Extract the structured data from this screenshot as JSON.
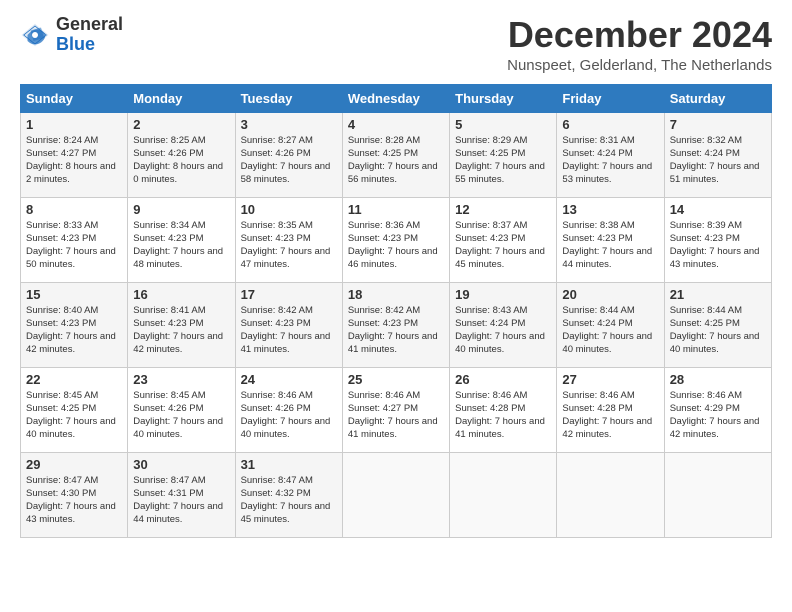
{
  "header": {
    "logo": {
      "general": "General",
      "blue": "Blue"
    },
    "title": "December 2024",
    "location": "Nunspeet, Gelderland, The Netherlands"
  },
  "calendar": {
    "columns": [
      "Sunday",
      "Monday",
      "Tuesday",
      "Wednesday",
      "Thursday",
      "Friday",
      "Saturday"
    ],
    "weeks": [
      [
        {
          "day": "1",
          "sunrise": "8:24 AM",
          "sunset": "4:27 PM",
          "daylight": "8 hours and 2 minutes."
        },
        {
          "day": "2",
          "sunrise": "8:25 AM",
          "sunset": "4:26 PM",
          "daylight": "8 hours and 0 minutes."
        },
        {
          "day": "3",
          "sunrise": "8:27 AM",
          "sunset": "4:26 PM",
          "daylight": "7 hours and 58 minutes."
        },
        {
          "day": "4",
          "sunrise": "8:28 AM",
          "sunset": "4:25 PM",
          "daylight": "7 hours and 56 minutes."
        },
        {
          "day": "5",
          "sunrise": "8:29 AM",
          "sunset": "4:25 PM",
          "daylight": "7 hours and 55 minutes."
        },
        {
          "day": "6",
          "sunrise": "8:31 AM",
          "sunset": "4:24 PM",
          "daylight": "7 hours and 53 minutes."
        },
        {
          "day": "7",
          "sunrise": "8:32 AM",
          "sunset": "4:24 PM",
          "daylight": "7 hours and 51 minutes."
        }
      ],
      [
        {
          "day": "8",
          "sunrise": "8:33 AM",
          "sunset": "4:23 PM",
          "daylight": "7 hours and 50 minutes."
        },
        {
          "day": "9",
          "sunrise": "8:34 AM",
          "sunset": "4:23 PM",
          "daylight": "7 hours and 48 minutes."
        },
        {
          "day": "10",
          "sunrise": "8:35 AM",
          "sunset": "4:23 PM",
          "daylight": "7 hours and 47 minutes."
        },
        {
          "day": "11",
          "sunrise": "8:36 AM",
          "sunset": "4:23 PM",
          "daylight": "7 hours and 46 minutes."
        },
        {
          "day": "12",
          "sunrise": "8:37 AM",
          "sunset": "4:23 PM",
          "daylight": "7 hours and 45 minutes."
        },
        {
          "day": "13",
          "sunrise": "8:38 AM",
          "sunset": "4:23 PM",
          "daylight": "7 hours and 44 minutes."
        },
        {
          "day": "14",
          "sunrise": "8:39 AM",
          "sunset": "4:23 PM",
          "daylight": "7 hours and 43 minutes."
        }
      ],
      [
        {
          "day": "15",
          "sunrise": "8:40 AM",
          "sunset": "4:23 PM",
          "daylight": "7 hours and 42 minutes."
        },
        {
          "day": "16",
          "sunrise": "8:41 AM",
          "sunset": "4:23 PM",
          "daylight": "7 hours and 42 minutes."
        },
        {
          "day": "17",
          "sunrise": "8:42 AM",
          "sunset": "4:23 PM",
          "daylight": "7 hours and 41 minutes."
        },
        {
          "day": "18",
          "sunrise": "8:42 AM",
          "sunset": "4:23 PM",
          "daylight": "7 hours and 41 minutes."
        },
        {
          "day": "19",
          "sunrise": "8:43 AM",
          "sunset": "4:24 PM",
          "daylight": "7 hours and 40 minutes."
        },
        {
          "day": "20",
          "sunrise": "8:44 AM",
          "sunset": "4:24 PM",
          "daylight": "7 hours and 40 minutes."
        },
        {
          "day": "21",
          "sunrise": "8:44 AM",
          "sunset": "4:25 PM",
          "daylight": "7 hours and 40 minutes."
        }
      ],
      [
        {
          "day": "22",
          "sunrise": "8:45 AM",
          "sunset": "4:25 PM",
          "daylight": "7 hours and 40 minutes."
        },
        {
          "day": "23",
          "sunrise": "8:45 AM",
          "sunset": "4:26 PM",
          "daylight": "7 hours and 40 minutes."
        },
        {
          "day": "24",
          "sunrise": "8:46 AM",
          "sunset": "4:26 PM",
          "daylight": "7 hours and 40 minutes."
        },
        {
          "day": "25",
          "sunrise": "8:46 AM",
          "sunset": "4:27 PM",
          "daylight": "7 hours and 41 minutes."
        },
        {
          "day": "26",
          "sunrise": "8:46 AM",
          "sunset": "4:28 PM",
          "daylight": "7 hours and 41 minutes."
        },
        {
          "day": "27",
          "sunrise": "8:46 AM",
          "sunset": "4:28 PM",
          "daylight": "7 hours and 42 minutes."
        },
        {
          "day": "28",
          "sunrise": "8:46 AM",
          "sunset": "4:29 PM",
          "daylight": "7 hours and 42 minutes."
        }
      ],
      [
        {
          "day": "29",
          "sunrise": "8:47 AM",
          "sunset": "4:30 PM",
          "daylight": "7 hours and 43 minutes."
        },
        {
          "day": "30",
          "sunrise": "8:47 AM",
          "sunset": "4:31 PM",
          "daylight": "7 hours and 44 minutes."
        },
        {
          "day": "31",
          "sunrise": "8:47 AM",
          "sunset": "4:32 PM",
          "daylight": "7 hours and 45 minutes."
        },
        null,
        null,
        null,
        null
      ]
    ]
  }
}
